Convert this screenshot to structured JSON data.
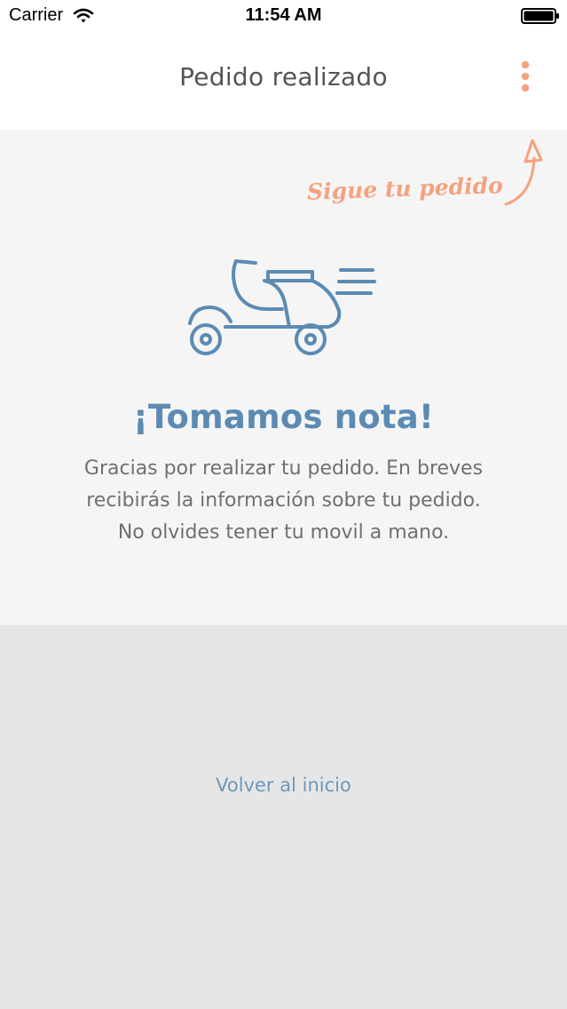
{
  "status_bar": {
    "carrier": "Carrier",
    "time": "11:54 AM",
    "wifi_icon": "wifi-icon",
    "battery_icon": "battery-icon"
  },
  "nav": {
    "title": "Pedido realizado",
    "menu_icon": "vertical-dots-icon"
  },
  "hint": {
    "text": "Sigue tu pedido",
    "arrow_icon": "curved-arrow-icon"
  },
  "confirmation": {
    "illustration_icon": "scooter-icon",
    "heading": "¡Tomamos nota!",
    "message_lines": [
      "Gracias por realizar tu pedido. En breves",
      "recibirás la información sobre tu pedido.",
      "No olvides tener tu movil a mano."
    ]
  },
  "footer": {
    "back_link": "Volver al inicio"
  },
  "colors": {
    "accent": "#f4a27f",
    "primary": "#5b8bb3",
    "text_gray": "#707070",
    "title_gray": "#555555",
    "link_blue": "#6f97b8",
    "footer_bg": "#e6e6e6",
    "main_bg": "#f5f5f5"
  }
}
